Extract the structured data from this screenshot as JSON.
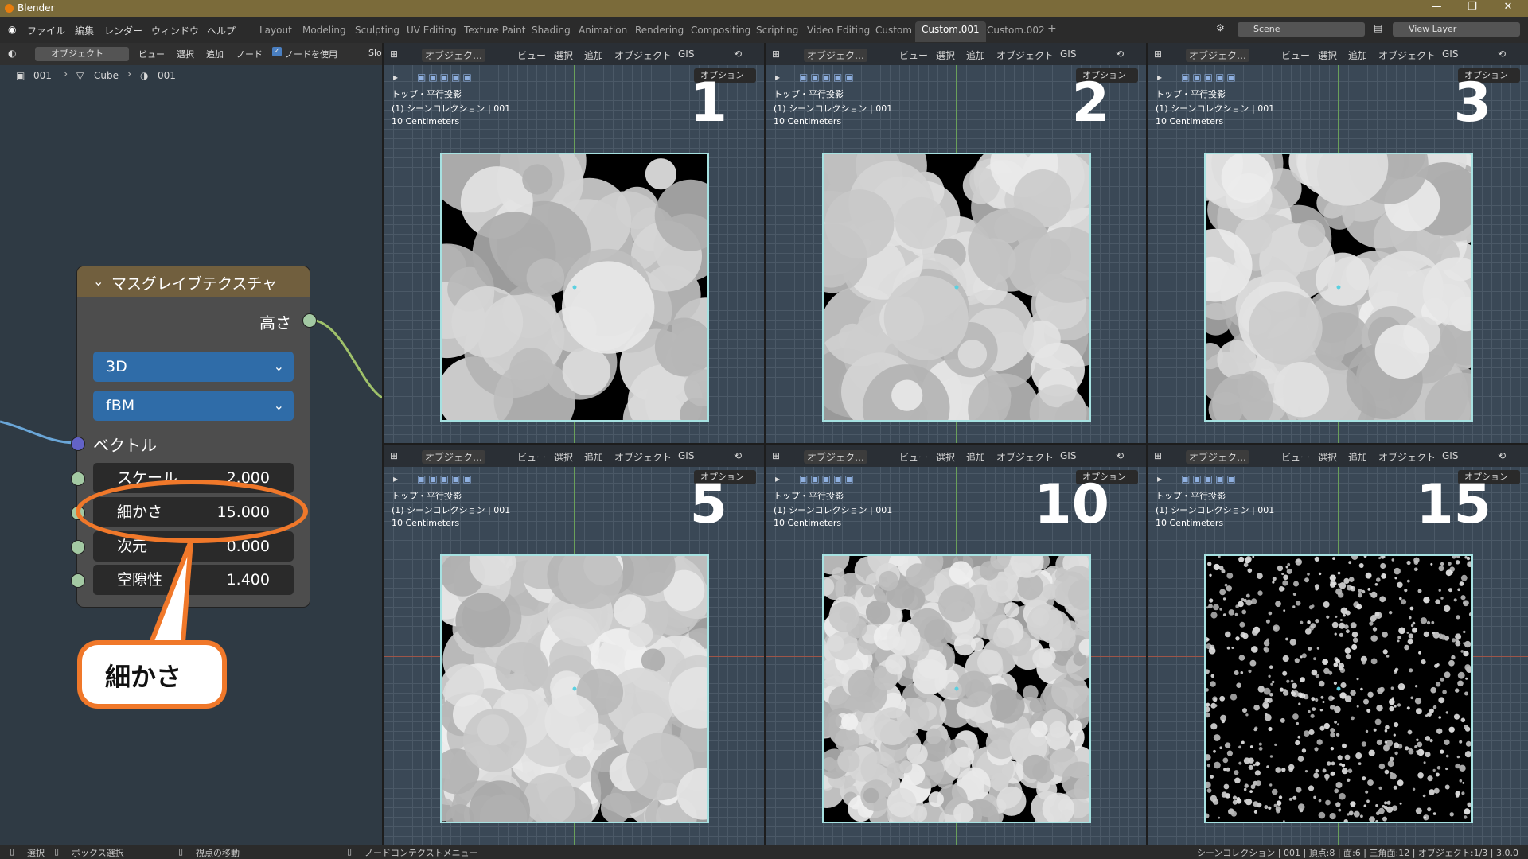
{
  "window": {
    "title": "Blender",
    "controls": [
      "—",
      "❐",
      "✕"
    ]
  },
  "menu": [
    "ファイル",
    "編集",
    "レンダー",
    "ウィンドウ",
    "ヘルプ"
  ],
  "workspaces": [
    "Layout",
    "Modeling",
    "Sculpting",
    "UV Editing",
    "Texture Paint",
    "Shading",
    "Animation",
    "Rendering",
    "Compositing",
    "Scripting",
    "Video Editing",
    "Custom",
    "Custom.001",
    "Custom.002",
    "+"
  ],
  "active_workspace": "Custom.001",
  "scene_field": "Scene",
  "view_layer_field": "View Layer",
  "node_editor": {
    "header": {
      "mode": "オブジェクト",
      "items": [
        "ビュー",
        "選択",
        "追加",
        "ノード"
      ],
      "use_nodes": "ノードを使用",
      "slot": "Slo"
    },
    "breadcrumb": [
      "001",
      "Cube",
      "001"
    ]
  },
  "node": {
    "title": "マスグレイブテクスチャ",
    "output": "高さ",
    "dimension": "3D",
    "type": "fBM",
    "vector_label": "ベクトル",
    "fields": [
      {
        "label": "スケール",
        "value": "2.000"
      },
      {
        "label": "細かさ",
        "value": "15.000"
      },
      {
        "label": "次元",
        "value": "0.000"
      },
      {
        "label": "空隙性",
        "value": "1.400"
      }
    ]
  },
  "callout": {
    "text": "細かさ"
  },
  "viewport_common": {
    "mode": "オブジェク…",
    "items": [
      "ビュー",
      "選択",
      "追加",
      "オブジェクト",
      "GIS"
    ],
    "options": "オプション",
    "info": [
      "トップ・平行投影",
      "(1) シーンコレクション | 001",
      "10 Centimeters"
    ]
  },
  "viewports": [
    {
      "number": "1"
    },
    {
      "number": "2"
    },
    {
      "number": "3"
    },
    {
      "number": "5"
    },
    {
      "number": "10"
    },
    {
      "number": "15"
    }
  ],
  "statusbar": {
    "left": [
      "選択",
      "ボックス選択",
      "視点の移動",
      "ノードコンテクストメニュー"
    ],
    "right": "シーンコレクション | 001 | 頂点:8 | 面:6 | 三角面:12 | オブジェクト:1/3 | 3.0.0"
  },
  "colors": {
    "accent_orange": "#f0782a",
    "node_header": "#715f3e",
    "dropdown_blue": "#2f6ca8"
  }
}
